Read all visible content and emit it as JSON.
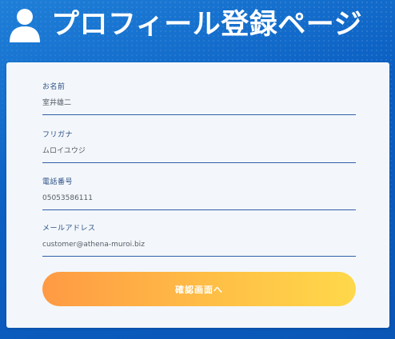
{
  "header": {
    "icon": "user-icon",
    "title": "プロフィール登録ページ"
  },
  "form": {
    "fields": [
      {
        "label": "お名前",
        "value": "室井雄二"
      },
      {
        "label": "フリガナ",
        "value": "ムロイユウジ"
      },
      {
        "label": "電話番号",
        "value": "05053586111"
      },
      {
        "label": "メールアドレス",
        "value": "customer@athena-muroi.biz"
      }
    ],
    "submit_label": "確認画面へ"
  },
  "colors": {
    "background": "#0b5fc2",
    "card": "#f3f7fb",
    "field_line": "#2f5fa8",
    "button_start": "#ff9a44",
    "button_end": "#ffd84a"
  }
}
